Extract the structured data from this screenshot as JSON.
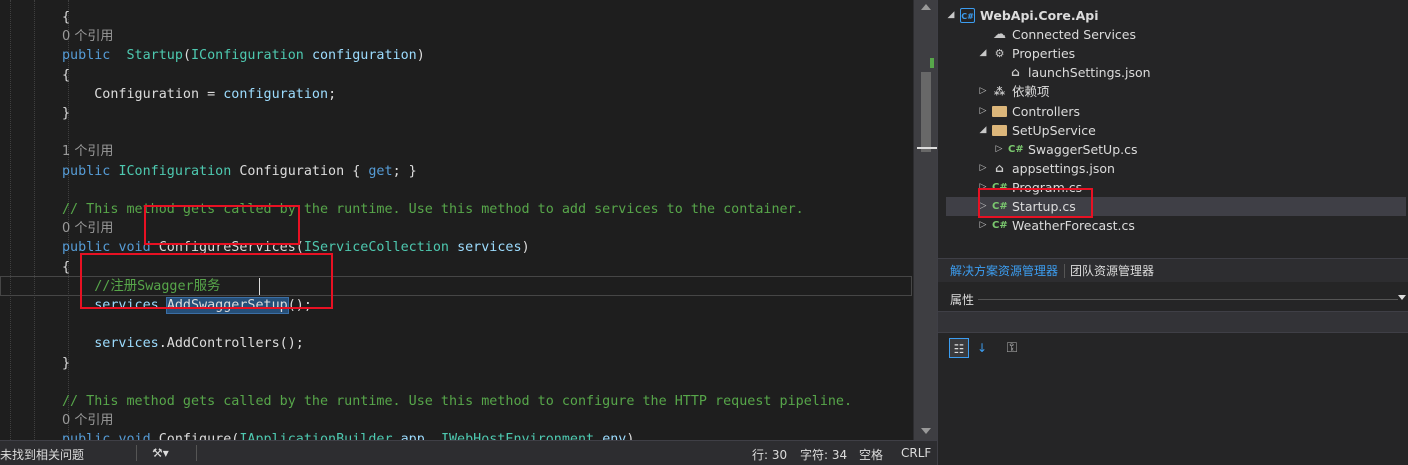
{
  "editor": {
    "code_lines": [
      {
        "kind": "code",
        "text": "{"
      },
      {
        "kind": "ref",
        "text": "0 个引用"
      },
      {
        "kind": "code",
        "tokens": [
          [
            "kw",
            "public"
          ],
          [
            "",
            "  "
          ],
          [
            "ty",
            "Startup"
          ],
          [
            "",
            "("
          ],
          [
            "ty",
            "IConfiguration"
          ],
          [
            "",
            " "
          ],
          [
            "pm",
            "configuration"
          ],
          [
            "",
            ")"
          ]
        ]
      },
      {
        "kind": "code",
        "text": "{"
      },
      {
        "kind": "code",
        "tokens": [
          [
            "",
            "    Configuration = "
          ],
          [
            "pm",
            "configuration"
          ],
          [
            "",
            ";"
          ]
        ]
      },
      {
        "kind": "code",
        "text": "}"
      },
      {
        "kind": "code",
        "text": ""
      },
      {
        "kind": "ref",
        "text": "1 个引用"
      },
      {
        "kind": "code",
        "tokens": [
          [
            "kw",
            "public"
          ],
          [
            "",
            " "
          ],
          [
            "ty",
            "IConfiguration"
          ],
          [
            "",
            " Configuration { "
          ],
          [
            "kw",
            "get"
          ],
          [
            "",
            "; }"
          ]
        ]
      },
      {
        "kind": "code",
        "text": ""
      },
      {
        "kind": "code",
        "tokens": [
          [
            "cm",
            "// This method gets called by the runtime. Use this method to add services to the container."
          ]
        ]
      },
      {
        "kind": "ref",
        "text": "0 个引用"
      },
      {
        "kind": "code",
        "tokens": [
          [
            "kw",
            "public"
          ],
          [
            "",
            " "
          ],
          [
            "kw",
            "void"
          ],
          [
            "",
            " ConfigureServices("
          ],
          [
            "ty",
            "IServiceCollection"
          ],
          [
            "",
            " "
          ],
          [
            "pm",
            "services"
          ],
          [
            "",
            ")"
          ]
        ]
      },
      {
        "kind": "code",
        "text": "{"
      },
      {
        "kind": "code",
        "tokens": [
          [
            "cm",
            "    //注册Swagger服务"
          ]
        ]
      },
      {
        "kind": "code",
        "tokens": [
          [
            "pm",
            "    services"
          ],
          [
            "",
            "."
          ],
          [
            "hl",
            "AddSwaggerSetup"
          ],
          [
            "",
            "();"
          ]
        ]
      },
      {
        "kind": "code",
        "text": ""
      },
      {
        "kind": "code",
        "tokens": [
          [
            "pm",
            "    services"
          ],
          [
            "",
            ".AddControllers();"
          ]
        ]
      },
      {
        "kind": "code",
        "text": "}"
      },
      {
        "kind": "code",
        "text": ""
      },
      {
        "kind": "code",
        "tokens": [
          [
            "cm",
            "// This method gets called by the runtime. Use this method to configure the HTTP request pipeline."
          ]
        ]
      },
      {
        "kind": "ref",
        "text": "0 个引用"
      },
      {
        "kind": "code",
        "tokens": [
          [
            "kw",
            "public"
          ],
          [
            "",
            " "
          ],
          [
            "kw",
            "void"
          ],
          [
            "",
            " Configure("
          ],
          [
            "ty",
            "IApplicationBuilder"
          ],
          [
            "",
            " "
          ],
          [
            "pm",
            "app"
          ],
          [
            "",
            ", "
          ],
          [
            "ty",
            "IWebHostEnvironment"
          ],
          [
            "",
            " "
          ],
          [
            "pm",
            "env"
          ],
          [
            "",
            ")"
          ]
        ]
      },
      {
        "kind": "code",
        "text": "{"
      }
    ]
  },
  "statusbar": {
    "issues": "未找到相关问题",
    "line": "行: 30",
    "char": "字符: 34",
    "spaces": "空格",
    "eol": "CRLF"
  },
  "solution_explorer": {
    "items": [
      {
        "label": "WebApi.Core.Api",
        "icon": "project-icon",
        "expander": "open",
        "bold": true
      },
      {
        "label": "Connected Services",
        "icon": "cloud-icon",
        "expander": "none"
      },
      {
        "label": "Properties",
        "icon": "properties-icon",
        "expander": "open"
      },
      {
        "label": "launchSettings.json",
        "icon": "json-file-icon",
        "expander": "none"
      },
      {
        "label": "依赖项",
        "icon": "dependencies-icon",
        "expander": "closed"
      },
      {
        "label": "Controllers",
        "icon": "folder-icon",
        "expander": "closed"
      },
      {
        "label": "SetUpService",
        "icon": "folder-icon",
        "expander": "open"
      },
      {
        "label": "SwaggerSetUp.cs",
        "icon": "csharp-file-icon",
        "expander": "closed"
      },
      {
        "label": "appsettings.json",
        "icon": "json-file-icon",
        "expander": "closed"
      },
      {
        "label": "Program.cs",
        "icon": "csharp-file-icon",
        "expander": "closed"
      },
      {
        "label": "Startup.cs",
        "icon": "csharp-file-icon",
        "expander": "closed",
        "selected": true
      },
      {
        "label": "WeatherForecast.cs",
        "icon": "csharp-file-icon",
        "expander": "closed"
      }
    ],
    "tabs": [
      "解决方案资源管理器",
      "团队资源管理器"
    ]
  },
  "properties": {
    "title": "属性"
  },
  "colors": {
    "background": "#1e1e1e",
    "keyword": "#569cd6",
    "type": "#4ec9b0",
    "comment": "#57a64a",
    "annotation": "#e81123",
    "accent": "#3c9df0"
  }
}
